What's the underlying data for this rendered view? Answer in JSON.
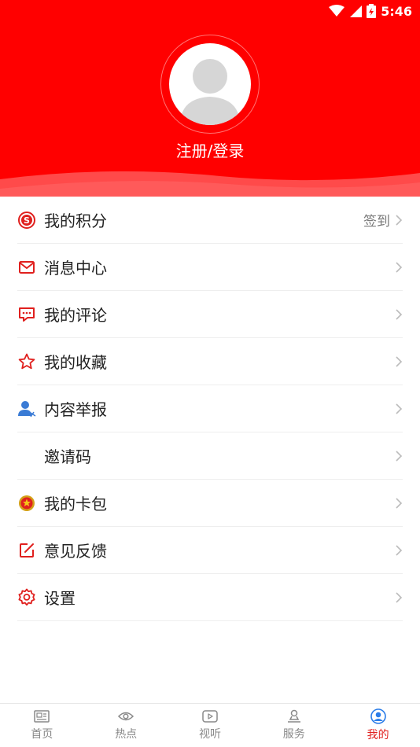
{
  "status_bar": {
    "time": "5:46"
  },
  "profile": {
    "login_label": "注册/登录"
  },
  "menu": {
    "items": [
      {
        "label": "我的积分",
        "extra": "签到",
        "icon": "points-coin-icon"
      },
      {
        "label": "消息中心",
        "extra": "",
        "icon": "envelope-icon"
      },
      {
        "label": "我的评论",
        "extra": "",
        "icon": "comment-icon"
      },
      {
        "label": "我的收藏",
        "extra": "",
        "icon": "star-icon"
      },
      {
        "label": "内容举报",
        "extra": "",
        "icon": "report-user-icon"
      },
      {
        "label": "邀请码",
        "extra": "",
        "icon": ""
      },
      {
        "label": "我的卡包",
        "extra": "",
        "icon": "emblem-icon"
      },
      {
        "label": "意见反馈",
        "extra": "",
        "icon": "edit-feedback-icon"
      },
      {
        "label": "设置",
        "extra": "",
        "icon": "gear-icon"
      }
    ]
  },
  "bottom_nav": {
    "items": [
      {
        "label": "首页",
        "icon": "news-icon"
      },
      {
        "label": "热点",
        "icon": "eye-icon"
      },
      {
        "label": "视听",
        "icon": "play-icon"
      },
      {
        "label": "服务",
        "icon": "service-icon"
      },
      {
        "label": "我的",
        "icon": "user-icon",
        "active": true
      }
    ]
  },
  "colors": {
    "brand_red": "#ff0000",
    "accent_red": "#e0201e",
    "text": "#222222",
    "muted": "#888888"
  }
}
